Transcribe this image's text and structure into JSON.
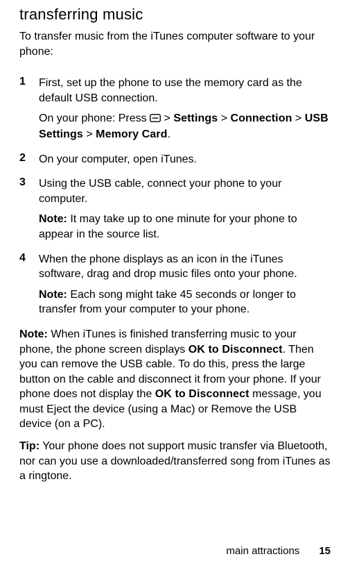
{
  "heading": "transferring music",
  "intro": "To transfer music from the iTunes computer software to your phone:",
  "steps": [
    {
      "num": "1",
      "text": "First, set up the phone to use the memory card as the default USB connection.",
      "sub_prefix": "On your phone: Press ",
      "sub_after_icon": " > ",
      "sub_b1": "Settings",
      "sub_mid1": "  > ",
      "sub_b2": "Connection",
      "sub_mid2": " > ",
      "sub_b3": "USB Settings",
      "sub_mid3": " > ",
      "sub_b4": "Memory Card",
      "sub_end": "."
    },
    {
      "num": "2",
      "text": "On your computer, open iTunes."
    },
    {
      "num": "3",
      "text": "Using the USB cable, connect your phone to your computer.",
      "note_label": "Note:",
      "note_text": " It may take up to one minute for your phone to appear in the source list."
    },
    {
      "num": "4",
      "text": " When the phone displays as an icon in the iTunes software, drag and drop music files onto your phone.",
      "note_label": "Note:",
      "note_text": " Each song might take 45 seconds or longer to transfer from your computer to your phone."
    }
  ],
  "bottom_note": {
    "label": "Note:",
    "t1": " When iTunes is finished transferring music to your phone, the phone screen displays ",
    "b1": "OK to Disconnect",
    "t2": ". Then you can remove the USB cable. To do this, press the large button on the cable and disconnect it from your phone. If your phone does not display the ",
    "b2": "OK to Disconnect",
    "t3": " message, you must Eject the device (using a Mac) or Remove the USB device (on a PC)."
  },
  "tip": {
    "label": "Tip:",
    "text": " Your phone does not support music transfer via Bluetooth, nor can you use a downloaded/transferred song from iTunes as a ringtone."
  },
  "footer": {
    "section": "main attractions",
    "page": "15"
  }
}
